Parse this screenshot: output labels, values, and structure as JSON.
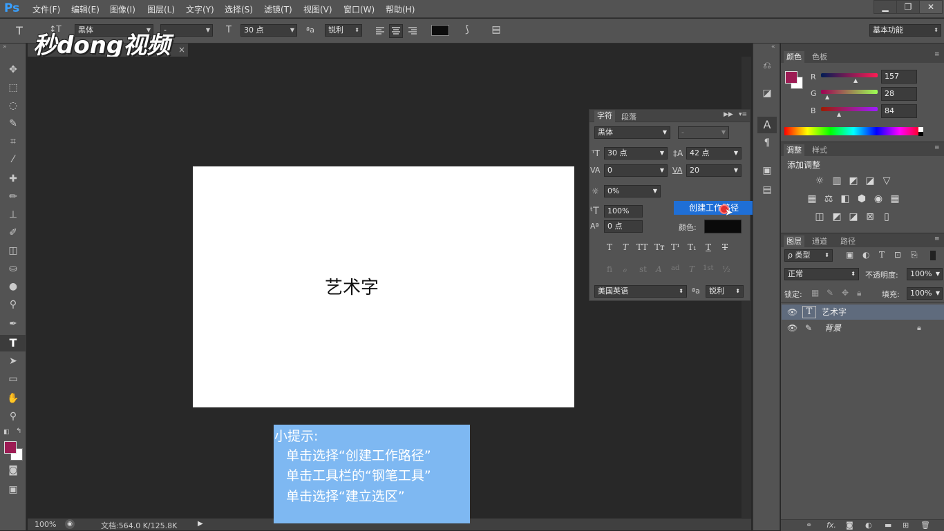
{
  "app": {
    "logo": "Ps"
  },
  "menu": [
    "文件(F)",
    "编辑(E)",
    "图像(I)",
    "图层(L)",
    "文字(Y)",
    "选择(S)",
    "滤镜(T)",
    "视图(V)",
    "窗口(W)",
    "帮助(H)"
  ],
  "window_controls": {
    "minimize": "▁",
    "restore": "❐",
    "close": "✕"
  },
  "options": {
    "tool_icon": "T",
    "orient_icon": "↕T",
    "font_family": "黑体",
    "font_style": "-",
    "size_icon": "T",
    "font_size": "30 点",
    "aa_icon": "ªa",
    "antialias": "锐利",
    "workspace": "基本功能"
  },
  "watermark": "秒dong视频",
  "doc_tab": {
    "close": "×"
  },
  "document": {
    "text": "艺术字"
  },
  "status": {
    "zoom": "100%",
    "doc_size": "文档:564.0 K/125.8K"
  },
  "tip": {
    "title": "小提示:",
    "lines": [
      "单击选择“创建工作路径”",
      "单击工具栏的“钢笔工具”",
      "单击选择“建立选区”"
    ]
  },
  "character_panel": {
    "tabs": [
      "字符",
      "段落"
    ],
    "font_family": "黑体",
    "font_style": "-",
    "size": "30 点",
    "leading": "42 点",
    "kerning": "0",
    "tracking": "20",
    "tsume": "0%",
    "vscale": "100%",
    "baseline": "0 点",
    "color_label": "颜色:",
    "language": "美国英语",
    "antialias": "锐利",
    "aa_icon": "ªa",
    "style_buttons": [
      "T",
      "T",
      "TT",
      "Tт",
      "T¹",
      "T₁",
      "T",
      "T"
    ],
    "opentype_buttons": [
      "fi",
      "ℴ",
      "st",
      "A",
      "ad",
      "T",
      "1st",
      "½"
    ]
  },
  "context_menu": {
    "item": "创建工作路径"
  },
  "color_panel": {
    "tabs": [
      "颜色",
      "色板"
    ],
    "r_label": "R",
    "g_label": "G",
    "b_label": "B",
    "r": "157",
    "g": "28",
    "b": "84",
    "foreground": "#9d1c54"
  },
  "adjustments_panel": {
    "tabs": [
      "调整",
      "样式"
    ],
    "title": "添加调整",
    "row1": [
      "☼",
      "▥",
      "◩",
      "◪",
      "▽"
    ],
    "row2": [
      "▦",
      "⚖",
      "◧",
      "⬢",
      "◉",
      "▦"
    ],
    "row3": [
      "◫",
      "◩",
      "◪",
      "⊠",
      "▯"
    ]
  },
  "layers_panel": {
    "tabs": [
      "图层",
      "通道",
      "路径"
    ],
    "filter": "ρ 类型",
    "blend": "正常",
    "opacity_label": "不透明度:",
    "opacity": "100%",
    "lock_label": "锁定:",
    "fill_label": "填充:",
    "fill": "100%",
    "layers": [
      {
        "name": "艺术字",
        "type_icon": "T",
        "selected": true
      },
      {
        "name": "背景",
        "type_icon": "✎",
        "selected": false
      }
    ],
    "footer_icons": [
      "⚭",
      "fx.",
      "◙",
      "◐",
      "▬",
      "⊞",
      "🗑"
    ]
  }
}
